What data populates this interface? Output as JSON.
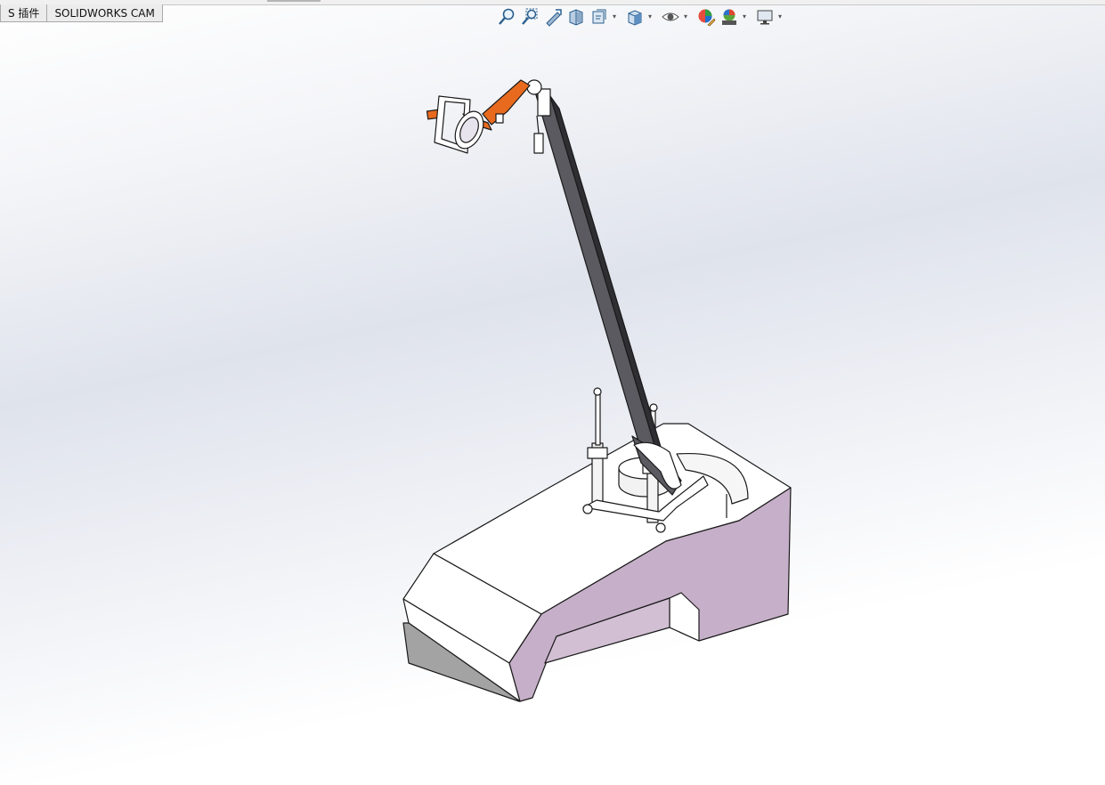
{
  "tabs": [
    {
      "label": "S 插件"
    },
    {
      "label": "SOLIDWORKS CAM"
    }
  ],
  "heads_up_toolbar": {
    "buttons": [
      {
        "name": "zoom-to-fit-icon"
      },
      {
        "name": "zoom-to-area-icon"
      },
      {
        "name": "previous-view-icon"
      },
      {
        "name": "section-view-icon"
      },
      {
        "name": "dynamic-annotation-views-icon"
      },
      {
        "name": "view-orientation-icon"
      },
      {
        "name": "display-style-icon"
      },
      {
        "name": "hide-show-items-icon"
      },
      {
        "name": "edit-appearance-icon"
      },
      {
        "name": "apply-scene-icon"
      },
      {
        "name": "view-settings-icon"
      }
    ]
  },
  "colors": {
    "accent_orange": "#e86a1f",
    "body_mauve": "#c6afc8",
    "arm_dark": "#4a4a4e",
    "edge": "#1a1a1a"
  }
}
